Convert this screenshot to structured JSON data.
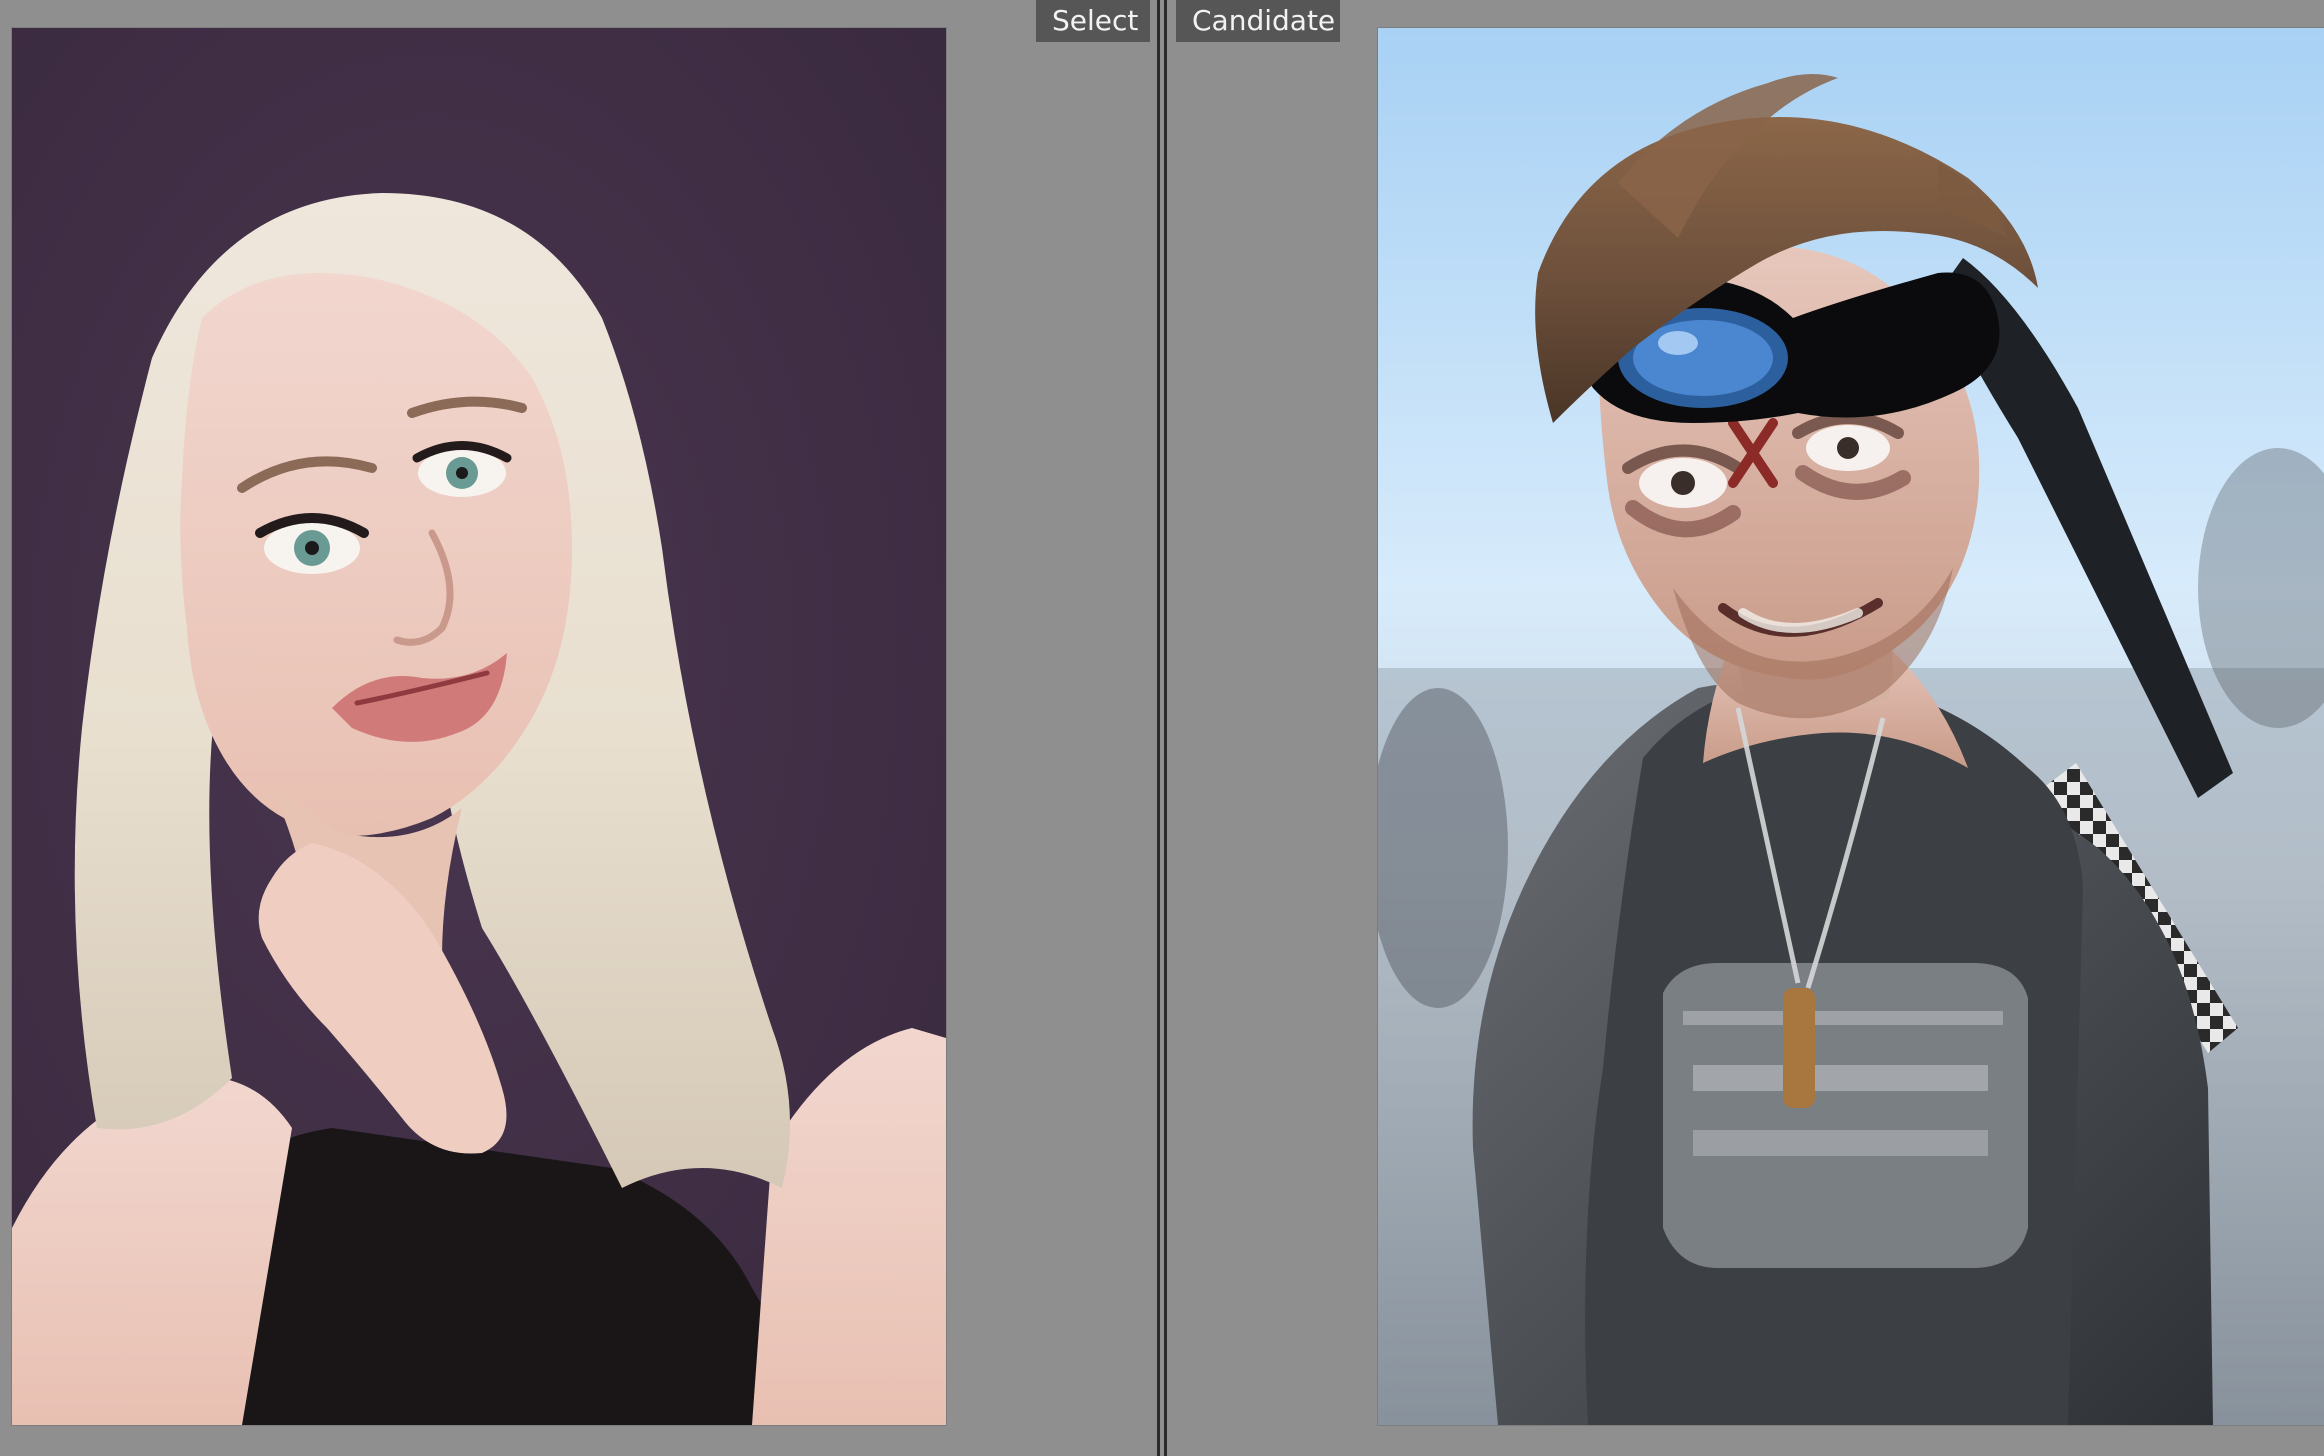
{
  "compare": {
    "select_label": "Select",
    "candidate_label": "Candidate"
  },
  "photos": {
    "select": {
      "subject": "blonde-woman-portrait"
    },
    "candidate": {
      "subject": "costumed-man-portrait"
    }
  }
}
